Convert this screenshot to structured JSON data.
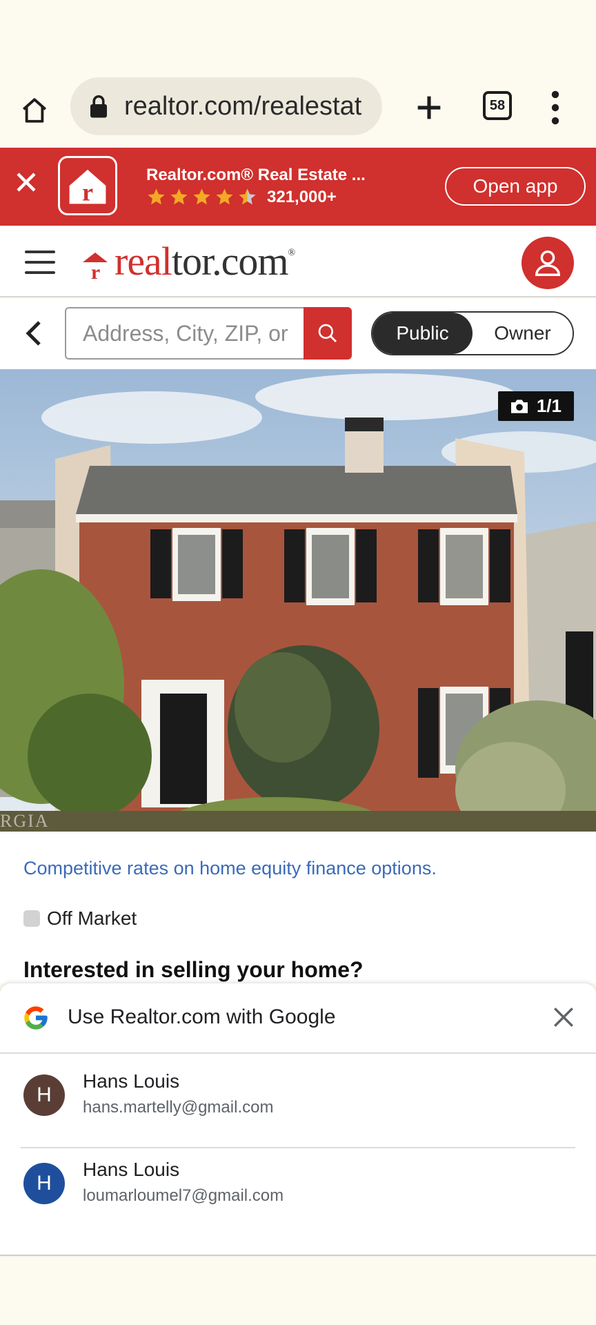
{
  "browser": {
    "url": "realtor.com/realestat",
    "tab_count": "58"
  },
  "app_banner": {
    "title": "Realtor.com® Real Estate ...",
    "rating_count": "321,000+",
    "rating": 4.5,
    "open_label": "Open app",
    "brand_color": "#d0302e"
  },
  "header": {
    "logo_red": "real",
    "logo_dark": "tor.com",
    "logo_mark": "®"
  },
  "search": {
    "placeholder": "Address, City, ZIP, or",
    "toggle_public": "Public",
    "toggle_owner": "Owner"
  },
  "photo": {
    "count": "1/1",
    "watermark": "RGIA"
  },
  "listing": {
    "promo_link": "Competitive rates on home equity finance options.",
    "status": "Off Market",
    "heading": "Interested in selling your home?"
  },
  "google_sheet": {
    "title": "Use Realtor.com with Google",
    "accounts": [
      {
        "initial": "H",
        "name": "Hans Louis",
        "email": "hans.martelly@gmail.com",
        "color": "#5a3e36"
      },
      {
        "initial": "H",
        "name": "Hans Louis",
        "email": "loumarloumel7@gmail.com",
        "color": "#1f4f9c"
      }
    ]
  }
}
